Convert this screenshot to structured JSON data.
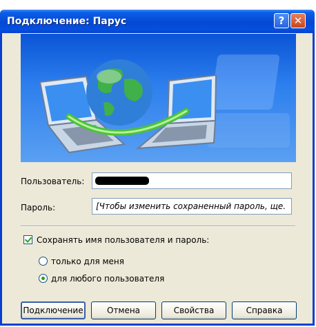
{
  "window": {
    "title": "Подключение: Парус",
    "help_glyph": "?",
    "close_glyph": "✕"
  },
  "form": {
    "user_label": "Пользователь:",
    "password_label": "Пароль:",
    "password_value": "[Чтобы изменить сохраненный пароль, ще.",
    "save_checkbox_label": "Сохранять имя пользователя и пароль:",
    "save_checked": true,
    "radio_me_label": "только для меня",
    "radio_anyone_label": "для любого пользователя",
    "selected_radio": "anyone"
  },
  "buttons": {
    "connect": "Подключение",
    "cancel": "Отмена",
    "properties": "Свойства",
    "help": "Справка"
  }
}
